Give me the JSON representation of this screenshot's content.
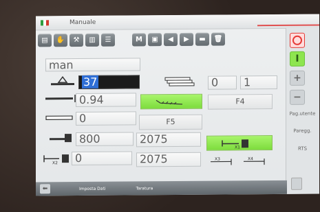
{
  "window": {
    "title": "Manuale",
    "flag_colors": [
      "#2e9e3f",
      "#ffffff",
      "#d23a2f"
    ]
  },
  "toolbar": {
    "icons": [
      "document-icon",
      "hand-icon",
      "wrench-icon",
      "chart-icon",
      "list-icon",
      "M",
      "save-icon",
      "arrow-left-icon",
      "arrow-right-icon",
      "minus-icon",
      "trash-icon"
    ],
    "m_label": "M"
  },
  "program": {
    "name": "man"
  },
  "row1": {
    "value": "37",
    "count_current": "0",
    "count_total": "1"
  },
  "row2": {
    "value": "0.94",
    "f4_label": "F4"
  },
  "row3": {
    "value": "0",
    "f5_label": "F5"
  },
  "row4": {
    "value": "800",
    "value2": "2075"
  },
  "row5": {
    "value": "0",
    "value2": "2075",
    "x3_label": "X3",
    "x4_label": "X4"
  },
  "right_panel": {
    "stop_color": "#e53935",
    "start_label": "I",
    "plus_label": "+",
    "minus_label": "−",
    "pag_utente": "Pag.utente",
    "paregg": "Paregg.",
    "rts": "RTS"
  },
  "bottom": {
    "imposta_dati": "Imposta Dati",
    "taratura": "Taratura"
  },
  "colors": {
    "accent_green": "#8ee54f",
    "selection_blue": "#2f6fd6"
  }
}
